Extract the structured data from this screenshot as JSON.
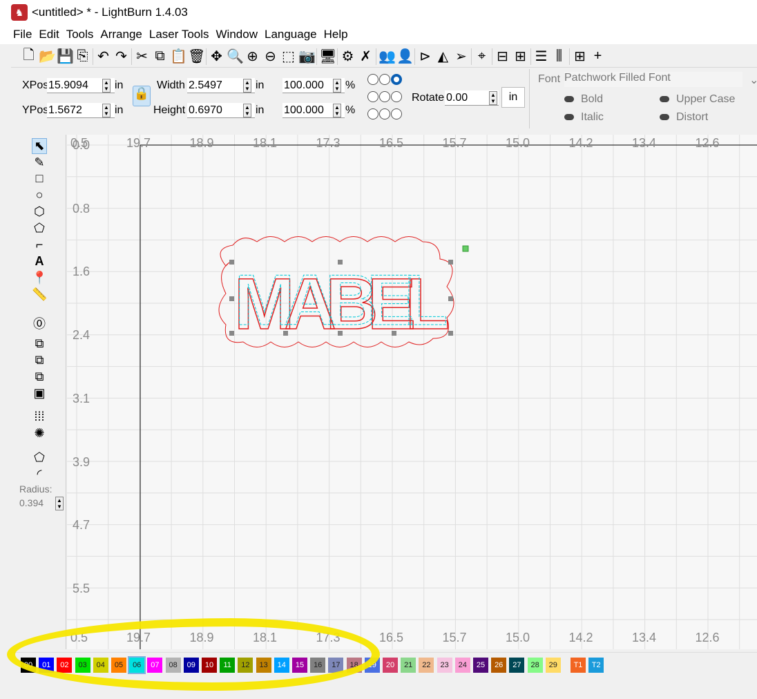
{
  "title": "<untitled> * - LightBurn 1.4.03",
  "menu": [
    "File",
    "Edit",
    "Tools",
    "Arrange",
    "Laser Tools",
    "Window",
    "Language",
    "Help"
  ],
  "toolbar_icons": [
    "new-file",
    "open-folder",
    "save",
    "import",
    "undo",
    "redo",
    "cut",
    "copy",
    "paste",
    "delete",
    "move",
    "zoom-page",
    "zoom-in",
    "zoom-out",
    "frame",
    "camera",
    "monitor",
    "settings",
    "tools",
    "users",
    "user",
    "mirror",
    "flip",
    "send",
    "target",
    "align",
    "distribute",
    "hdistribute",
    "vdistribute",
    "grid",
    "dock"
  ],
  "props": {
    "xpos_label": "XPos",
    "xpos": "15.9094",
    "ypos_label": "YPos",
    "ypos": "1.5672",
    "unit": "in",
    "width_label": "Width",
    "width": "2.5497",
    "height_label": "Height",
    "height": "0.6970",
    "scale_x": "100.000",
    "scale_y": "100.000",
    "pct": "%",
    "rotate_label": "Rotate",
    "rotate": "0.00",
    "rotate_unit": "in"
  },
  "font": {
    "label": "Font",
    "value": "Patchwork Filled Font",
    "bold": "Bold",
    "italic": "Italic",
    "upper": "Upper Case",
    "distort": "Distort"
  },
  "left_tools": {
    "radius_label": "Radius:",
    "radius": "0.394"
  },
  "ruler_x": [
    "0.5",
    "19.7",
    "18.9",
    "18.1",
    "17.3",
    "16.5",
    "15.7",
    "15.0",
    "14.2",
    "13.4",
    "12.6"
  ],
  "ruler_y": [
    "0.0",
    "0.8",
    "1.6",
    "2.4",
    "3.1",
    "3.9",
    "4.7",
    "5.5"
  ],
  "design_text": "MABEL",
  "palette": [
    {
      "l": "00",
      "c": "#000000"
    },
    {
      "l": "01",
      "c": "#0000ff"
    },
    {
      "l": "02",
      "c": "#ff0000"
    },
    {
      "l": "03",
      "c": "#00e000"
    },
    {
      "l": "04",
      "c": "#d0d000"
    },
    {
      "l": "05",
      "c": "#ff8000"
    },
    {
      "l": "06",
      "c": "#00e0e0"
    },
    {
      "l": "07",
      "c": "#ff00ff"
    },
    {
      "l": "08",
      "c": "#b4b4b4"
    },
    {
      "l": "09",
      "c": "#0000a0"
    },
    {
      "l": "10",
      "c": "#a00000"
    },
    {
      "l": "11",
      "c": "#00a000"
    },
    {
      "l": "12",
      "c": "#a0a000"
    },
    {
      "l": "13",
      "c": "#c08000"
    },
    {
      "l": "14",
      "c": "#00a0ff"
    },
    {
      "l": "15",
      "c": "#a000a0"
    },
    {
      "l": "16",
      "c": "#808080"
    },
    {
      "l": "17",
      "c": "#7d87b9"
    },
    {
      "l": "18",
      "c": "#bb7784"
    },
    {
      "l": "19",
      "c": "#4a6fe3"
    },
    {
      "l": "20",
      "c": "#d33f6a"
    },
    {
      "l": "21",
      "c": "#8cd78c"
    },
    {
      "l": "22",
      "c": "#f0b98d"
    },
    {
      "l": "23",
      "c": "#f6c4e1"
    },
    {
      "l": "24",
      "c": "#fa9ed4"
    },
    {
      "l": "25",
      "c": "#500a78"
    },
    {
      "l": "26",
      "c": "#b45a00"
    },
    {
      "l": "27",
      "c": "#004754"
    },
    {
      "l": "28",
      "c": "#86fa88"
    },
    {
      "l": "29",
      "c": "#ffdb66"
    },
    {
      "l": "T1",
      "c": "#f26522"
    },
    {
      "l": "T2",
      "c": "#1a9bdb"
    }
  ]
}
